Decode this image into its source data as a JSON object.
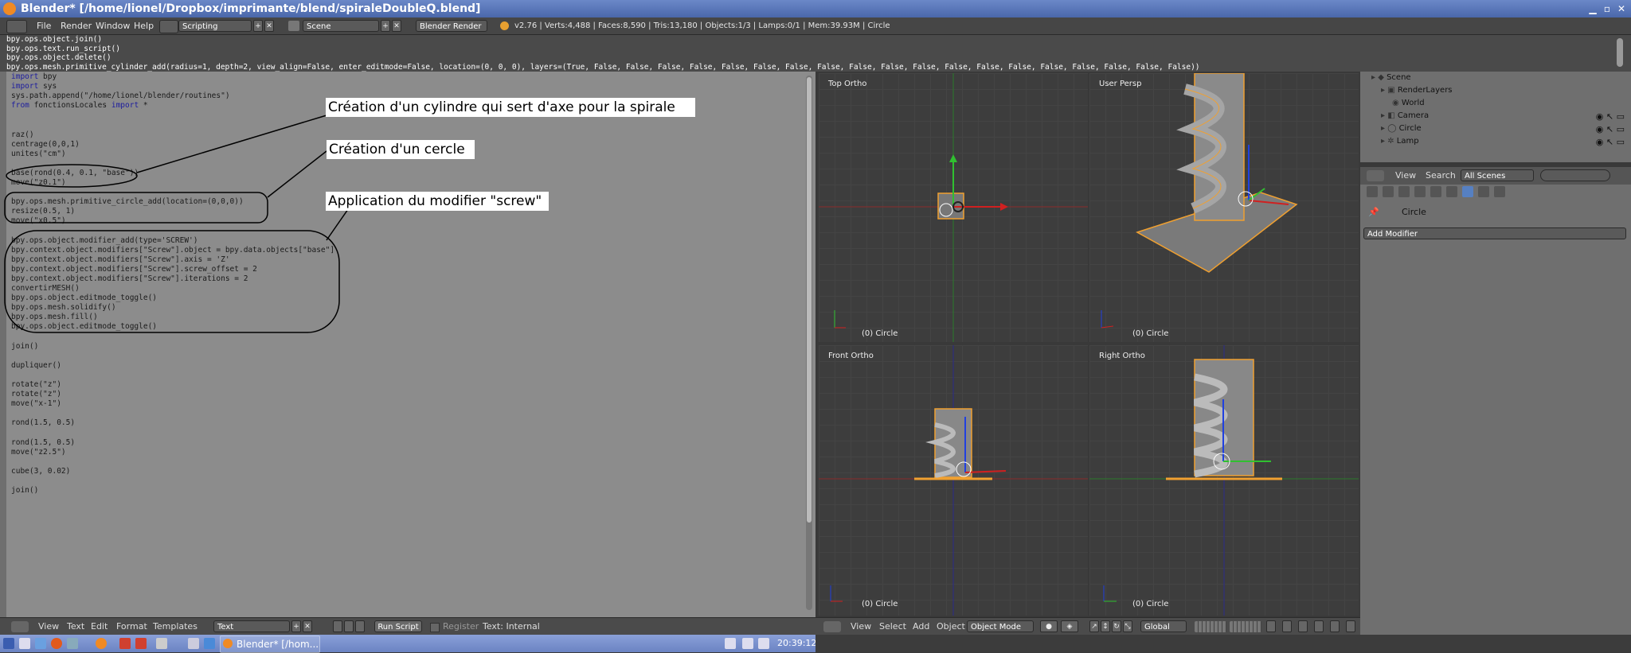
{
  "window": {
    "title": "Blender* [/home/lionel/Dropbox/imprimante/blend/spiraleDoubleQ.blend]"
  },
  "info_header": {
    "menus": [
      "File",
      "Render",
      "Window",
      "Help"
    ],
    "screen_layout": "Scripting",
    "scene": "Scene",
    "render_engine": "Blender Render",
    "stats": "v2.76 | Verts:4,488 | Faces:8,590 | Tris:13,180 | Objects:1/3 | Lamps:0/1 | Mem:39.93M | Circle"
  },
  "python_log": [
    "bpy.ops.object.join()",
    "bpy.ops.text.run_script()",
    "bpy.ops.object.delete()",
    "bpy.ops.mesh.primitive_cylinder_add(radius=1, depth=2, view_align=False, enter_editmode=False, location=(0, 0, 0), layers=(True, False, False, False, False, False, False, False, False, False, False, False, False, False, False, False, False, False, False, False))"
  ],
  "code_lines": [
    "import bpy",
    "import sys",
    "sys.path.append(\"/home/lionel/blender/routines\")",
    "from fonctionsLocales import *",
    "",
    "",
    "raz()",
    "centrage(0,0,1)",
    "unites(\"cm\")",
    "",
    "base(rond(0.4, 0.1, \"base\"))",
    "move(\"z0.1\")",
    "",
    "bpy.ops.mesh.primitive_circle_add(location=(0,0,0))",
    "resize(0.5, 1)",
    "move(\"x0.5\")",
    "",
    "bpy.ops.object.modifier_add(type='SCREW')",
    "bpy.context.object.modifiers[\"Screw\"].object = bpy.data.objects[\"base\"]",
    "bpy.context.object.modifiers[\"Screw\"].axis = 'Z'",
    "bpy.context.object.modifiers[\"Screw\"].screw_offset = 2",
    "bpy.context.object.modifiers[\"Screw\"].iterations = 2",
    "convertirMESH()",
    "bpy.ops.object.editmode_toggle()",
    "bpy.ops.mesh.solidify()",
    "bpy.ops.mesh.fill()",
    "bpy.ops.object.editmode_toggle()",
    "",
    "join()",
    "",
    "dupliquer()",
    "",
    "rotate(\"z\")",
    "rotate(\"z\")",
    "move(\"x-1\")",
    "",
    "rond(1.5, 0.5)",
    "",
    "rond(1.5, 0.5)",
    "move(\"z2.5\")",
    "",
    "cube(3, 0.02)",
    "",
    "join()"
  ],
  "annotations": [
    "Création d'un cylindre qui sert d'axe pour la spirale",
    "Création d'un cercle",
    "Application du modifier \"screw\""
  ],
  "viewports": {
    "top_left": {
      "label": "Top Ortho",
      "footer": "(0) Circle"
    },
    "top_right": {
      "label": "User Persp",
      "footer": "(0) Circle"
    },
    "bottom_left": {
      "label": "Front Ortho",
      "footer": "(0) Circle"
    },
    "bottom_right": {
      "label": "Right Ortho",
      "footer": "(0) Circle"
    }
  },
  "outliner": {
    "items": [
      "Scene",
      "RenderLayers",
      "World",
      "Camera",
      "Circle",
      "Lamp"
    ]
  },
  "properties": {
    "view": "View",
    "search": "Search",
    "filter": "All Scenes",
    "object_name": "Circle",
    "add_modifier": "Add Modifier"
  },
  "text_editor_header": {
    "menus": [
      "View",
      "Text",
      "Edit",
      "Format",
      "Templates"
    ],
    "text_name": "Text",
    "run_script": "Run Script",
    "register": "Register",
    "status": "Text: Internal"
  },
  "view3d_header": {
    "menus": [
      "View",
      "Select",
      "Add",
      "Object"
    ],
    "mode": "Object Mode",
    "orientation": "Global"
  },
  "taskbar": {
    "window_button": "Blender* [/hom...",
    "clock": "20:39:12"
  },
  "colors": {
    "x_axis": "#d02020",
    "y_axis": "#30c030",
    "z_axis": "#2040e0",
    "selection": "#f0a030"
  }
}
